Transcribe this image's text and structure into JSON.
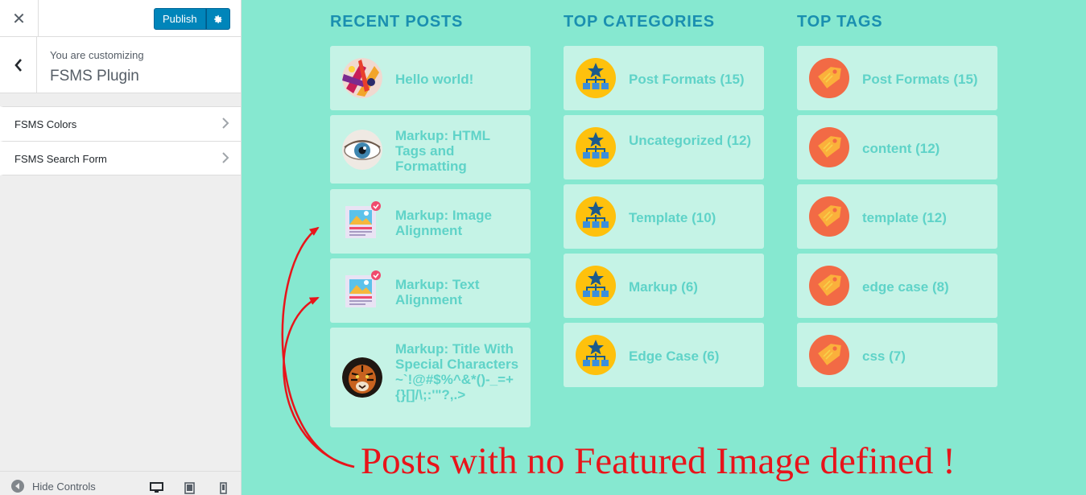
{
  "topbar": {
    "close_symbol": "✕",
    "publish_label": "Publish",
    "settings_icon": "gear-icon"
  },
  "panel": {
    "customizing_label": "You are customizing",
    "title": "FSMS Plugin"
  },
  "sections": [
    {
      "label": "FSMS Colors"
    },
    {
      "label": "FSMS Search Form"
    }
  ],
  "footer": {
    "hide_controls_label": "Hide Controls"
  },
  "columns": {
    "recent_posts": {
      "title": "RECENT POSTS",
      "items": [
        {
          "text": "Hello world!",
          "thumb": "paint-splash-thumbnail"
        },
        {
          "text": "Markup: HTML Tags and Formatting",
          "thumb": "eye-thumbnail"
        },
        {
          "text": "Markup: Image Alignment",
          "thumb": "default-image-placeholder"
        },
        {
          "text": "Markup: Text Alignment",
          "thumb": "default-image-placeholder"
        },
        {
          "text": "Markup: Title With Special Characters ~`!@#$%^&*()-_=+{}[]/\\;:'\"?,.>",
          "thumb": "tiger-thumbnail"
        }
      ]
    },
    "top_categories": {
      "title": "TOP CATEGORIES",
      "items": [
        {
          "text": "Post Formats (15)"
        },
        {
          "text": "Uncategorized (12)"
        },
        {
          "text": "Template (10)"
        },
        {
          "text": "Markup (6)"
        },
        {
          "text": "Edge Case (6)"
        }
      ]
    },
    "top_tags": {
      "title": "TOP TAGS",
      "items": [
        {
          "text": "Post Formats (15)"
        },
        {
          "text": "content (12)"
        },
        {
          "text": "template (12)"
        },
        {
          "text": "edge case (8)"
        },
        {
          "text": "css (7)"
        }
      ]
    }
  },
  "annotation": {
    "text": "Posts with no Featured Image defined !"
  },
  "colors": {
    "preview_background": "#86e8d0",
    "card_background": "#c5f3e6",
    "heading": "#1a8fb0",
    "card_text": "#5fd3c8",
    "publish_blue": "#0085ba",
    "annotation_red": "#e8141a"
  }
}
